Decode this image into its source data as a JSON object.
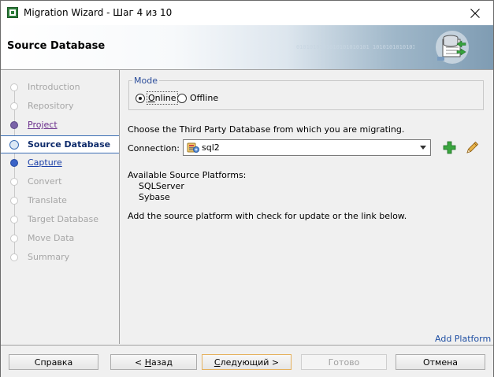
{
  "window": {
    "title": "Migration Wizard - Шаг 4 из 10",
    "header_title": "Source Database",
    "header_pattern": "0101010101010101010101 101010101010101 0101010101 1010101 01010101010101010 1010 101010101 010101010"
  },
  "nav": {
    "items": [
      {
        "label": "Introduction",
        "state": "disabled"
      },
      {
        "label": "Repository",
        "state": "disabled"
      },
      {
        "label": "Project",
        "state": "visited"
      },
      {
        "label": "Source Database",
        "state": "current"
      },
      {
        "label": "Capture",
        "state": "link"
      },
      {
        "label": "Convert",
        "state": "disabled"
      },
      {
        "label": "Translate",
        "state": "disabled"
      },
      {
        "label": "Target Database",
        "state": "disabled"
      },
      {
        "label": "Move Data",
        "state": "disabled"
      },
      {
        "label": "Summary",
        "state": "disabled"
      }
    ]
  },
  "mode": {
    "legend": "Mode",
    "online": {
      "label": "Online",
      "mnemonic": "O",
      "rest": "nline",
      "selected": true
    },
    "offline": {
      "label": "Offline",
      "prefix": "Off",
      "mnemonic": "l",
      "rest": "ine",
      "selected": false
    }
  },
  "main": {
    "choose_text": "Choose the Third Party Database from which you are migrating.",
    "connection_label": "Connection:",
    "connection_value": "sql2",
    "platforms_label": "Available Source Platforms:",
    "platforms": [
      "SQLServer",
      "Sybase"
    ],
    "add_note": "Add the source platform with check for update or the link below.",
    "add_platform_link": "Add Platform"
  },
  "footer": {
    "help": "Справка",
    "back": "< Назад",
    "back_parts": [
      "< ",
      "Н",
      "азад"
    ],
    "next": "Следующий >",
    "next_parts": [
      "",
      "С",
      "ледующий >"
    ],
    "finish": "Готово",
    "cancel": "Отмена"
  },
  "colors": {
    "accent": "#1f4fa3",
    "visited": "#6a2e8c",
    "disabled": "#a6a6a6",
    "primary_border": "#e5b15e"
  }
}
